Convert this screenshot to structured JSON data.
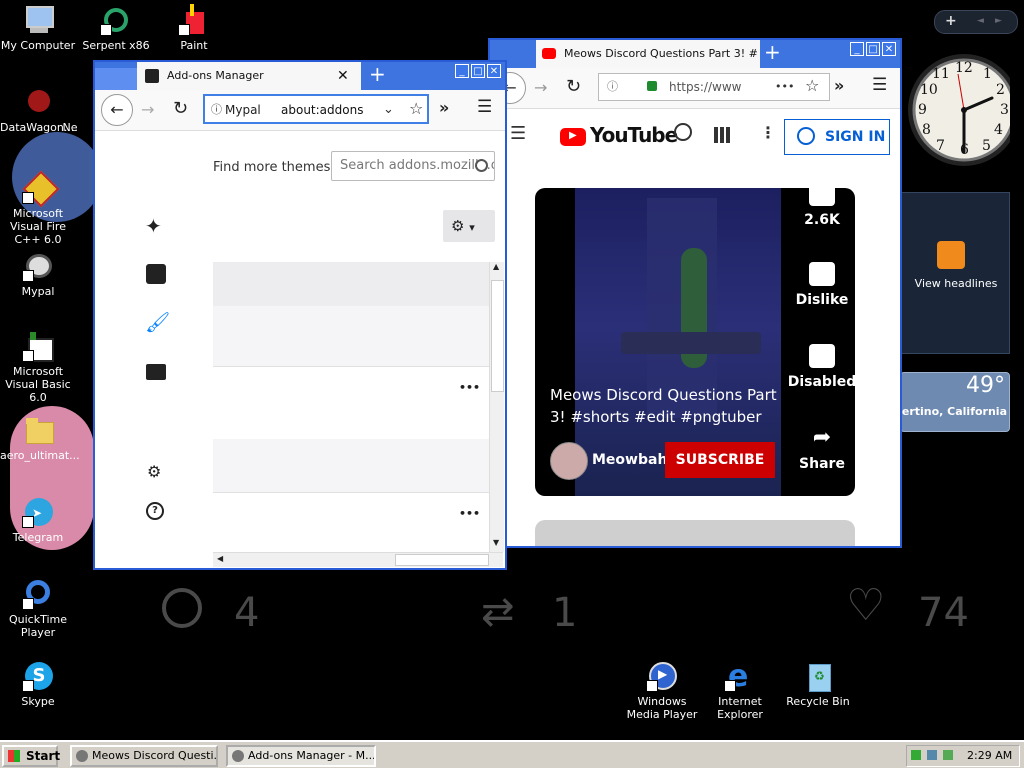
{
  "desktop": {
    "icons": [
      {
        "label": "My Computer",
        "icon": "computer-icon"
      },
      {
        "label": "Serpent x86",
        "icon": "snake-icon"
      },
      {
        "label": "Paint",
        "icon": "paint-icon"
      },
      {
        "label": "DataWagon....",
        "icon": "datawagon-icon"
      },
      {
        "label": "Ne",
        "icon": "ne-icon"
      },
      {
        "label": "Microsoft Visual Fire C++ 6.0",
        "icon": "visual-cpp-icon"
      },
      {
        "label": "Mypal",
        "icon": "mypal-icon"
      },
      {
        "label": "Microsoft Visual Basic 6.0",
        "icon": "visual-basic-icon"
      },
      {
        "label": "aero_ultimat...",
        "icon": "folder-icon"
      },
      {
        "label": "Telegram",
        "icon": "telegram-icon"
      },
      {
        "label": "QuickTime Player",
        "icon": "quicktime-icon"
      },
      {
        "label": "Skype",
        "icon": "skype-icon"
      },
      {
        "label": "Windows Media Player",
        "icon": "media-player-icon"
      },
      {
        "label": "Internet Explorer",
        "icon": "ie-icon"
      },
      {
        "label": "Recycle Bin",
        "icon": "recycle-bin-icon"
      }
    ],
    "background_stats": {
      "replies": "4",
      "retweets": "1",
      "likes": "74"
    }
  },
  "gadgets": {
    "clock": {
      "numbers": [
        "12",
        "1",
        "2",
        "3",
        "4",
        "5",
        "6",
        "7",
        "8",
        "9",
        "10",
        "11"
      ]
    },
    "feed": {
      "label": "View headlines"
    },
    "weather": {
      "temperature": "49°",
      "location": "Cupertino, California"
    },
    "sidebar_controls": {
      "add": "+",
      "prev": "◄",
      "next": "►"
    }
  },
  "addons_window": {
    "tab_title": "Add-ons Manager",
    "new_tab": "+",
    "identity_label": "Mypal",
    "url": "about:addons",
    "find_more": "Find more themes",
    "search_placeholder": "Search addons.mozilla.org",
    "gear_caret": "▾",
    "more": "•••"
  },
  "youtube_window": {
    "tab_title": "Meows Discord Questions Part 3! #",
    "new_tab": "+",
    "url": "https://www",
    "more_dots": "•••",
    "logo_text": "YouTube",
    "sign_in": "SIGN IN",
    "video": {
      "title": "Meows Discord Questions Part 3! #shorts #edit #pngtuber",
      "channel": "Meowbahh",
      "subscribe": "SUBSCRIBE",
      "likes": "2.6K",
      "dislike": "Dislike",
      "comments": "Disabled",
      "share": "Share"
    }
  },
  "taskbar": {
    "start": "Start",
    "tasks": [
      "Meows Discord Questi...",
      "Add-ons Manager - M..."
    ],
    "time": "2:29 AM"
  },
  "colors": {
    "youtube_red": "#ff0000",
    "subscribe_red": "#cc0000",
    "xp_blue": "#3d74e0",
    "signin_blue": "#065fd4"
  }
}
